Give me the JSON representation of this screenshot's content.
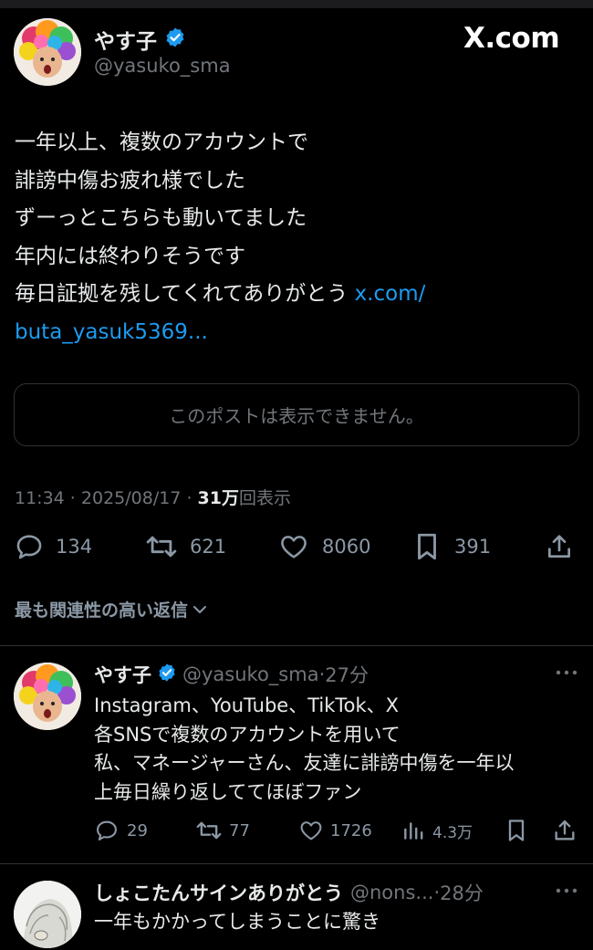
{
  "main_post": {
    "author_name": "やす子",
    "author_handle": "@yasuko_sma",
    "site_logo": "X.com",
    "text_lines": [
      "一年以上、複数のアカウントで",
      "誹謗中傷お疲れ様でした",
      "ずーっとこちらも動いてました",
      "年内には終わりそうです",
      "毎日証拠を残してくれてありがとう "
    ],
    "link_line1": "x.com/",
    "link_line2": "buta_yasuk5369...",
    "quote_unavailable": "このポストは表示できません。",
    "time": "11:34",
    "separator": " · ",
    "date": "2025/08/17",
    "views_number": "31万",
    "views_label": "回表示",
    "replies": "134",
    "reposts": "621",
    "likes": "8060",
    "bookmarks": "391"
  },
  "sort_label": "最も関連性の高い返信",
  "replies": [
    {
      "author_name": "やす子",
      "author_handle": "@yasuko_sma",
      "time": "27分",
      "text_lines": [
        "Instagram、YouTube、TikTok、X",
        "各SNSで複数のアカウントを用いて",
        "私、マネージャーさん、友達に誹謗中傷を一年以",
        "上毎日繰り返しててほぼファン"
      ],
      "replies": "29",
      "reposts": "77",
      "likes": "1726",
      "views": "4.3万"
    },
    {
      "author_name": "しょこたんサインありがとう",
      "author_handle": "@nons...",
      "time": "28分",
      "text_lines": [
        "一年もかかってしまうことに驚き"
      ]
    }
  ],
  "icons": [
    "verified-badge-icon",
    "reply-icon",
    "repost-icon",
    "like-icon",
    "bookmark-icon",
    "share-icon",
    "views-icon",
    "chevron-down-icon",
    "more-icon"
  ],
  "colors": {
    "background": "#000000",
    "text": "#e7e9ea",
    "secondary": "#71767b",
    "link": "#1d9bf0",
    "border": "#2f3336"
  }
}
